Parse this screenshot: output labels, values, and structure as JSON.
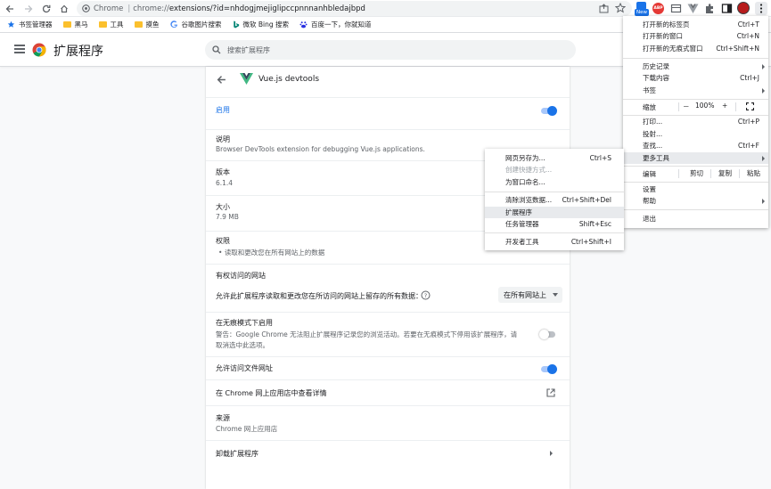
{
  "address_bar": {
    "site_label": "Chrome",
    "url_scheme": "chrome://",
    "url_rest": "extensions/?id=nhdogjmejiglipccpnnnanhbledajbpd",
    "new_badge": "New",
    "abp_label": "ABP"
  },
  "bookmarks": [
    {
      "label": "书签管理器",
      "icon": "star-icon"
    },
    {
      "label": "黑马",
      "icon": "folder-icon"
    },
    {
      "label": "工具",
      "icon": "folder-icon"
    },
    {
      "label": "摸鱼",
      "icon": "folder-icon"
    },
    {
      "label": "谷歌图片搜索",
      "icon": "google-icon"
    },
    {
      "label": "微软 Bing 搜索",
      "icon": "bing-icon"
    },
    {
      "label": "百度一下，你就知道",
      "icon": "baidu-icon"
    }
  ],
  "header": {
    "title": "扩展程序",
    "search_placeholder": "搜索扩展程序"
  },
  "extension": {
    "name": "Vue.js devtools",
    "enabled_label": "启用",
    "description_title": "说明",
    "description": "Browser DevTools extension for debugging Vue.js applications.",
    "version_title": "版本",
    "version": "6.1.4",
    "size_title": "大小",
    "size": "7.9 MB",
    "permissions_title": "权限",
    "permission_item": "读取和更改您在所有网站上的数据",
    "site_access_title": "有权访问的网站",
    "site_access_desc": "允许此扩展程序读取和更改您在所访问的网站上留存的所有数据：",
    "site_access_value": "在所有网站上",
    "incognito_title": "在无痕模式下启用",
    "incognito_warning_1": "警告：Google Chrome 无法阻止扩展程序记录您的浏览活动。若要在无痕模式下停用该扩展程序，请",
    "incognito_warning_2": "取消选中此选项。",
    "file_access": "允许访问文件网址",
    "store_link": "在 Chrome 网上应用店中查看详情",
    "source_title": "来源",
    "source": "Chrome 网上应用店",
    "uninstall": "卸载扩展程序"
  },
  "main_menu": {
    "new_tab": {
      "label": "打开新的标签页",
      "shortcut": "Ctrl+T"
    },
    "new_window": {
      "label": "打开新的窗口",
      "shortcut": "Ctrl+N"
    },
    "incognito": {
      "label": "打开新的无痕式窗口",
      "shortcut": "Ctrl+Shift+N"
    },
    "history": {
      "label": "历史记录"
    },
    "downloads": {
      "label": "下载内容",
      "shortcut": "Ctrl+J"
    },
    "bookmarks": {
      "label": "书签"
    },
    "zoom": {
      "label": "缩放",
      "minus": "－",
      "value": "100%",
      "plus": "+"
    },
    "print": {
      "label": "打印...",
      "shortcut": "Ctrl+P"
    },
    "cast": {
      "label": "投射..."
    },
    "find": {
      "label": "查找...",
      "shortcut": "Ctrl+F"
    },
    "more_tools": {
      "label": "更多工具"
    },
    "edit": {
      "label": "编辑",
      "cut": "剪切",
      "copy": "复制",
      "paste": "粘贴"
    },
    "settings": {
      "label": "设置"
    },
    "help": {
      "label": "帮助"
    },
    "exit": {
      "label": "退出"
    }
  },
  "sub_menu": {
    "save_page": {
      "label": "网页另存为...",
      "shortcut": "Ctrl+S"
    },
    "create_shortcut": {
      "label": "创建快捷方式..."
    },
    "name_window": {
      "label": "为窗口命名..."
    },
    "clear_data": {
      "label": "清除浏览数据...",
      "shortcut": "Ctrl+Shift+Del"
    },
    "extensions": {
      "label": "扩展程序"
    },
    "task_manager": {
      "label": "任务管理器",
      "shortcut": "Shift+Esc"
    },
    "devtools": {
      "label": "开发者工具",
      "shortcut": "Ctrl+Shift+I"
    }
  },
  "colors": {
    "accent": "#1a73e8",
    "vue_green": "#41b883",
    "vue_dark": "#34495e",
    "menu_highlight": "#e8eaed"
  }
}
